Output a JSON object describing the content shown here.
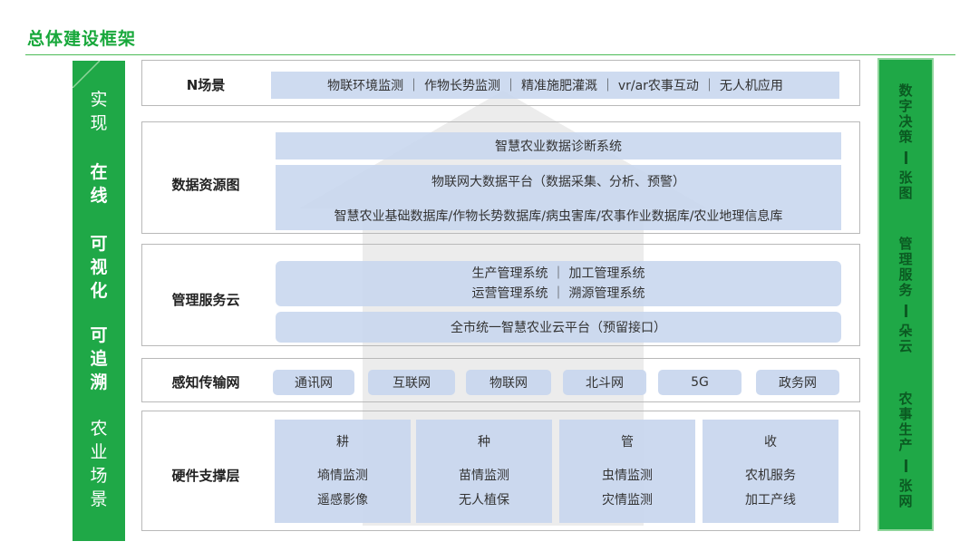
{
  "page_title": "总体建设框架",
  "left_bar": {
    "groups": [
      {
        "chars": [
          "实",
          "现"
        ],
        "bold": false
      },
      {
        "chars": [
          "在",
          "线"
        ],
        "bold": true
      },
      {
        "chars": [
          "可",
          "视",
          "化"
        ],
        "bold": true
      },
      {
        "chars": [
          "可",
          "追",
          "溯"
        ],
        "bold": true
      },
      {
        "chars": [
          "农",
          "业",
          "场",
          "景"
        ],
        "bold": false
      }
    ]
  },
  "right_bar": {
    "groups": [
      {
        "top": [
          "数",
          "字",
          "决",
          "策"
        ],
        "bottom": [
          "张",
          "图"
        ]
      },
      {
        "top": [
          "管",
          "理",
          "服",
          "务"
        ],
        "bottom": [
          "朵",
          "云"
        ]
      },
      {
        "top": [
          "农",
          "事",
          "生",
          "产"
        ],
        "bottom": [
          "张",
          "网"
        ]
      }
    ]
  },
  "rows": {
    "scenes": {
      "label": "N场景",
      "text": "物联环境监测 ｜ 作物长势监测 ｜  精准施肥灌溉 ｜  vr/ar农事互动 ｜  无人机应用"
    },
    "data_resources": {
      "label": "数据资源图",
      "line1": "智慧农业数据诊断系统",
      "line2": "物联网大数据平台（数据采集、分析、预警）",
      "line3": "智慧农业基础数据库/作物长势数据库/病虫害库/农事作业数据库/农业地理信息库"
    },
    "mgmt_cloud": {
      "label": "管理服务云",
      "systems_line1": "生产管理系统  ｜  加工管理系统",
      "systems_line2": "运营管理系统  ｜   溯源管理系统",
      "platform": "全市统一智慧农业云平台（预留接口）"
    },
    "network": {
      "label": "感知传输网",
      "items": [
        "通讯网",
        "互联网",
        "物联网",
        "北斗网",
        "5G",
        "政务网"
      ]
    },
    "hardware": {
      "label": "硬件支撑层",
      "columns": [
        {
          "title": "耕",
          "items": [
            "墒情监测",
            "遥感影像"
          ]
        },
        {
          "title": "种",
          "items": [
            "苗情监测",
            "无人植保"
          ]
        },
        {
          "title": "管",
          "items": [
            "虫情监测",
            "灾情监测"
          ]
        },
        {
          "title": "收",
          "items": [
            "农机服务",
            "加工产线"
          ]
        }
      ]
    }
  },
  "colors": {
    "brand_green": "#1fa847",
    "title_green": "#18a83b",
    "cell_blue": "#c9d7ee",
    "house_gray": "#e6e6e6"
  }
}
